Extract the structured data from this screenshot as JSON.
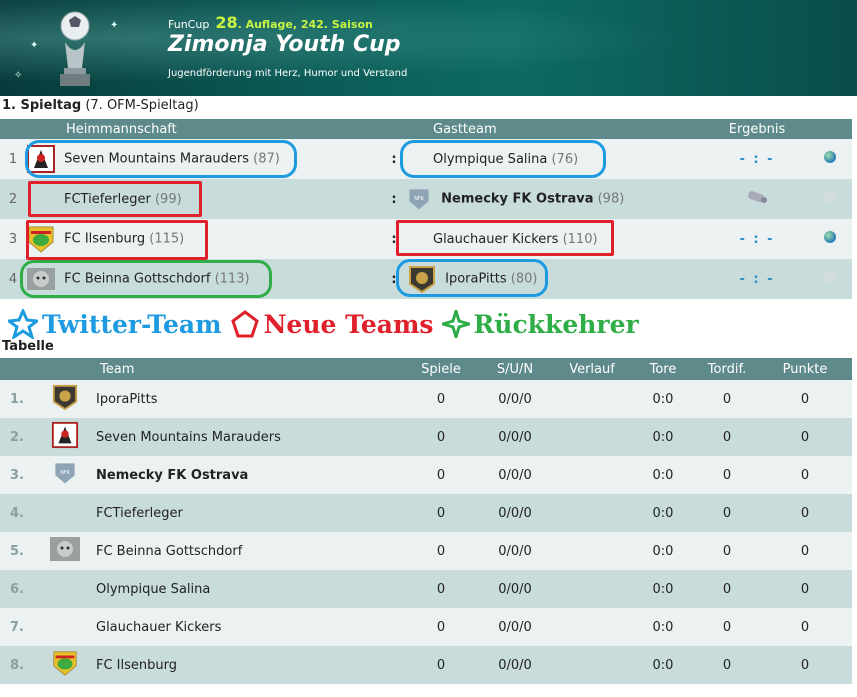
{
  "header": {
    "brand": "FunCup",
    "edition_number": "28",
    "edition_text": ". Auflage, 242. Saison",
    "title": "Zimonja Youth Cup",
    "subtitle": "Jugendförderung mit Herz, Humor und Verstand"
  },
  "fixtures": {
    "heading_bold": "1. Spieltag",
    "heading_rest": " (7. OFM-Spieltag)",
    "columns": {
      "home": "Heimmannschaft",
      "away": "Gastteam",
      "result": "Ergebnis"
    },
    "separator": ":",
    "matches": [
      {
        "num": "1",
        "home": "Seven Mountains Marauders",
        "home_rating": "(87)",
        "away": "Olympique Salina",
        "away_rating": "(76)",
        "result": "- : -"
      },
      {
        "num": "2",
        "home": "FCTieferleger",
        "home_rating": "(99)",
        "away": "Nemecky FK Ostrava",
        "away_rating": "(98)",
        "result": ""
      },
      {
        "num": "3",
        "home": "FC Ilsenburg",
        "home_rating": "(115)",
        "away": "Glauchauer Kickers",
        "away_rating": "(110)",
        "result": "- : -"
      },
      {
        "num": "4",
        "home": "FC Beinna Gottschdorf",
        "home_rating": "(113)",
        "away": "IporaPitts",
        "away_rating": "(80)",
        "result": "- : -"
      }
    ]
  },
  "legend": {
    "twitter": "Twitter-Team",
    "new": "Neue Teams",
    "returning": "Rückkehrer",
    "colors": {
      "twitter": "#1e9be0",
      "new": "#e0202a",
      "returning": "#2fae47"
    }
  },
  "table": {
    "heading": "Tabelle",
    "columns": {
      "team": "Team",
      "games": "Spiele",
      "sun": "S/U/N",
      "trend": "Verlauf",
      "goals": "Tore",
      "diff": "Tordif.",
      "points": "Punkte"
    },
    "rows": [
      {
        "rank": "1.",
        "team": "IporaPitts",
        "games": "0",
        "sun": "0/0/0",
        "goals": "0:0",
        "diff": "0",
        "points": "0"
      },
      {
        "rank": "2.",
        "team": "Seven Mountains Marauders",
        "games": "0",
        "sun": "0/0/0",
        "goals": "0:0",
        "diff": "0",
        "points": "0"
      },
      {
        "rank": "3.",
        "team": "Nemecky FK Ostrava",
        "games": "0",
        "sun": "0/0/0",
        "goals": "0:0",
        "diff": "0",
        "points": "0"
      },
      {
        "rank": "4.",
        "team": "FCTieferleger",
        "games": "0",
        "sun": "0/0/0",
        "goals": "0:0",
        "diff": "0",
        "points": "0"
      },
      {
        "rank": "5.",
        "team": "FC Beinna Gottschdorf",
        "games": "0",
        "sun": "0/0/0",
        "goals": "0:0",
        "diff": "0",
        "points": "0"
      },
      {
        "rank": "6.",
        "team": "Olympique Salina",
        "games": "0",
        "sun": "0/0/0",
        "goals": "0:0",
        "diff": "0",
        "points": "0"
      },
      {
        "rank": "7.",
        "team": "Glauchauer Kickers",
        "games": "0",
        "sun": "0/0/0",
        "goals": "0:0",
        "diff": "0",
        "points": "0"
      },
      {
        "rank": "8.",
        "team": "FC Ilsenburg",
        "games": "0",
        "sun": "0/0/0",
        "goals": "0:0",
        "diff": "0",
        "points": "0"
      }
    ]
  }
}
